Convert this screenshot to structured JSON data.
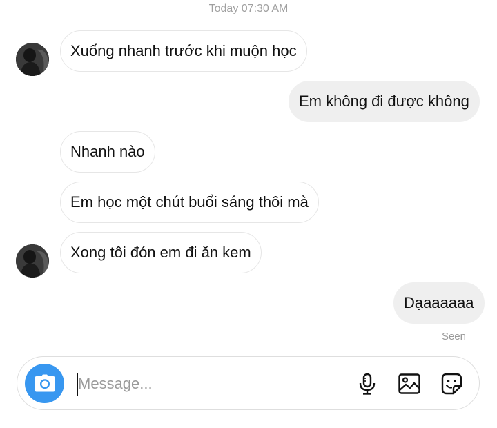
{
  "thread": {
    "timestamp": "Today 07:30 AM",
    "messages": [
      {
        "sender": "them",
        "text": "Xuống nhanh trước khi muộn học",
        "avatar": true
      },
      {
        "sender": "me",
        "text": "Em không đi được không"
      },
      {
        "sender": "them",
        "text": "Nhanh nào",
        "avatar": false
      },
      {
        "sender": "them",
        "text": "Em học một chút buổi sáng thôi mà",
        "avatar": false
      },
      {
        "sender": "them",
        "text": "Xong tôi đón em đi ăn kem",
        "avatar": true
      },
      {
        "sender": "me",
        "text": "Dạaaaaaa"
      }
    ],
    "seen_label": "Seen"
  },
  "composer": {
    "placeholder": "Message...",
    "value": "",
    "icons": {
      "camera": "camera-icon",
      "microphone": "microphone-icon",
      "gallery": "image-gallery-icon",
      "sticker": "sticker-icon"
    }
  },
  "colors": {
    "camera_button": "#3897f0",
    "outgoing_bubble": "#efefef",
    "incoming_border": "#e6e6e6",
    "meta_text": "#a0a0a0"
  }
}
